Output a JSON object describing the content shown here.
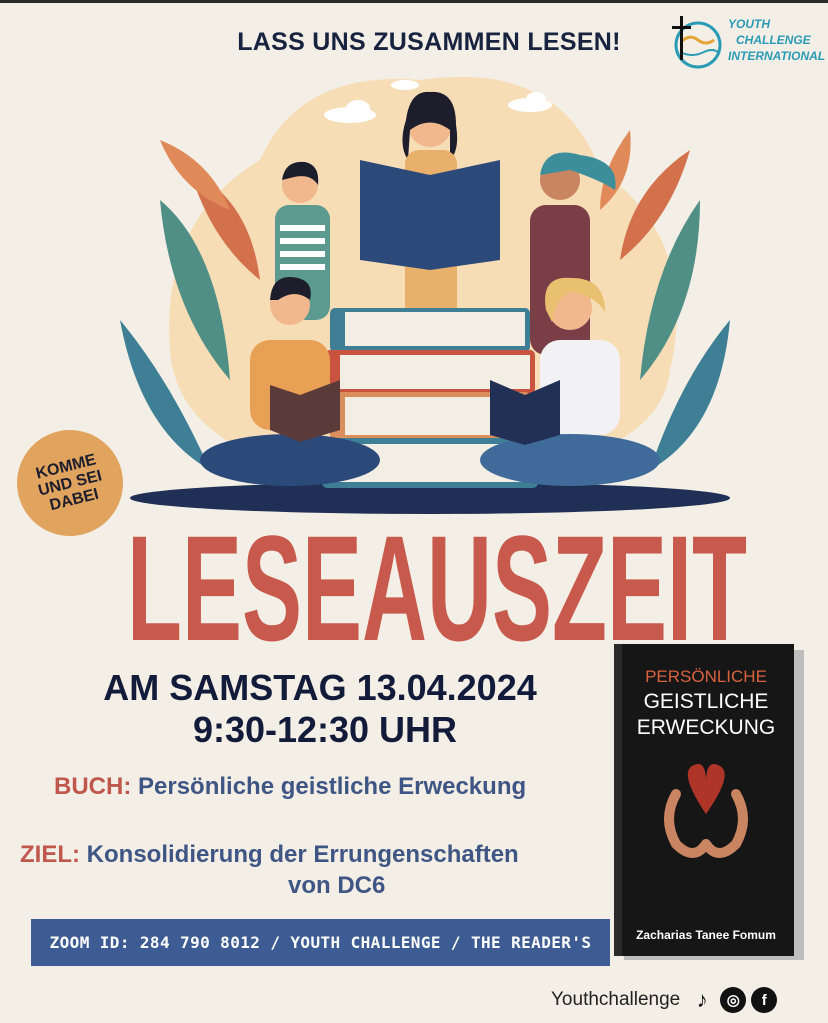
{
  "header": {
    "headline": "LASS UNS ZUSAMMEN LESEN!"
  },
  "logo": {
    "line1": "YOUTH",
    "line2": "CHALLENGE",
    "line3": "INTERNATIONAL"
  },
  "badge": {
    "text": "KOMME\nUND SEI\nDABEI"
  },
  "title": "LESEAUSZEIT",
  "event": {
    "date": "AM SAMSTAG 13.04.2024",
    "time": "9:30-12:30 UHR"
  },
  "buch": {
    "label": "BUCH:",
    "value": "Persönliche geistliche Erweckung"
  },
  "ziel": {
    "label": "ZIEL:",
    "value_line1": "Konsolidierung der Errungenschaften",
    "value_line2": "von DC6"
  },
  "zoom": {
    "text": "ZOOM ID: 284 790 8012 / YOUTH CHALLENGE / THE READER'S"
  },
  "book_cover": {
    "title_line1": "PERSÖNLICHE",
    "title_line2": "GEISTLICHE",
    "title_line3": "ERWECKUNG",
    "author": "Zacharias Tanee Fomum"
  },
  "social": {
    "handle": "Youthchallenge",
    "icons": [
      "tiktok-icon",
      "instagram-icon",
      "facebook-icon"
    ]
  },
  "colors": {
    "background": "#f4efe6",
    "title_red": "#c85a4d",
    "navy": "#131b3a",
    "label_red": "#c0574c",
    "value_blue": "#3f5685",
    "zoom_bar": "#3c5c93",
    "badge_orange": "#e0a45f"
  }
}
